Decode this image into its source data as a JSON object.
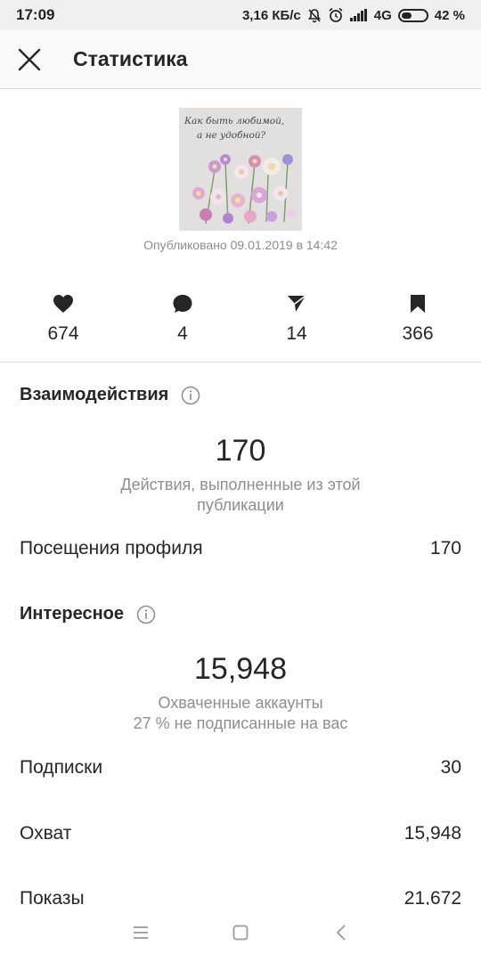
{
  "status_bar": {
    "time": "17:09",
    "speed": "3,16 КБ/с",
    "network": "4G",
    "battery": "42 %"
  },
  "header": {
    "title": "Статистика",
    "close_icon": "close-icon"
  },
  "post": {
    "image_text_line1": "Как быть любимой,",
    "image_text_line2": "а не удобной?",
    "published": "Опубликовано 09.01.2019 в 14:42"
  },
  "counts": {
    "likes": "674",
    "comments": "4",
    "shares": "14",
    "saves": "366"
  },
  "interactions": {
    "title": "Взаимодействия",
    "value": "170",
    "desc_line1": "Действия, выполненные из этой",
    "desc_line2": "публикации",
    "rows": [
      {
        "label": "Посещения профиля",
        "value": "170"
      }
    ]
  },
  "discovery": {
    "title": "Интересное",
    "value": "15,948",
    "desc_line1": "Охваченные аккаунты",
    "desc_line2": "27 % не подписанные на вас",
    "rows": [
      {
        "label": "Подписки",
        "value": "30"
      },
      {
        "label": "Охват",
        "value": "15,948"
      },
      {
        "label": "Показы",
        "value": "21,672"
      }
    ]
  },
  "colors": {
    "text": "#262626",
    "secondary": "#8e8e8e",
    "divider": "#dbdbdb"
  }
}
